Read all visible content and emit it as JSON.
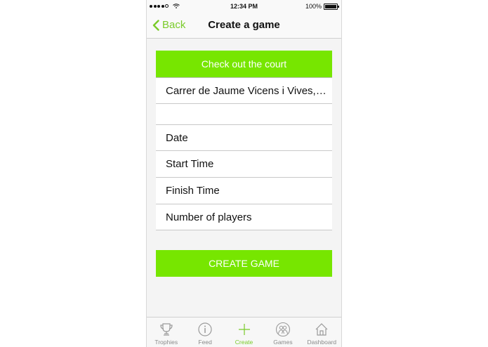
{
  "status_bar": {
    "time": "12:34 PM",
    "battery": "100%"
  },
  "navbar": {
    "back_label": "Back",
    "title": "Create a game"
  },
  "form": {
    "check_court_label": "Check out the court",
    "court_address": "Carrer de Jaume Vicens i Vives,…",
    "empty_row": "",
    "date_label": "Date",
    "start_time_label": "Start Time",
    "finish_time_label": "Finish Time",
    "players_label": "Number of players",
    "create_label": "CREATE GAME"
  },
  "tabs": [
    {
      "label": "Trophies",
      "icon": "trophy-icon"
    },
    {
      "label": "Feed",
      "icon": "info-icon"
    },
    {
      "label": "Create",
      "icon": "plus-icon",
      "active": true
    },
    {
      "label": "Games",
      "icon": "people-icon"
    },
    {
      "label": "Dashboard",
      "icon": "home-icon"
    }
  ],
  "colors": {
    "accent": "#77e600",
    "tint": "#7acb2a"
  }
}
